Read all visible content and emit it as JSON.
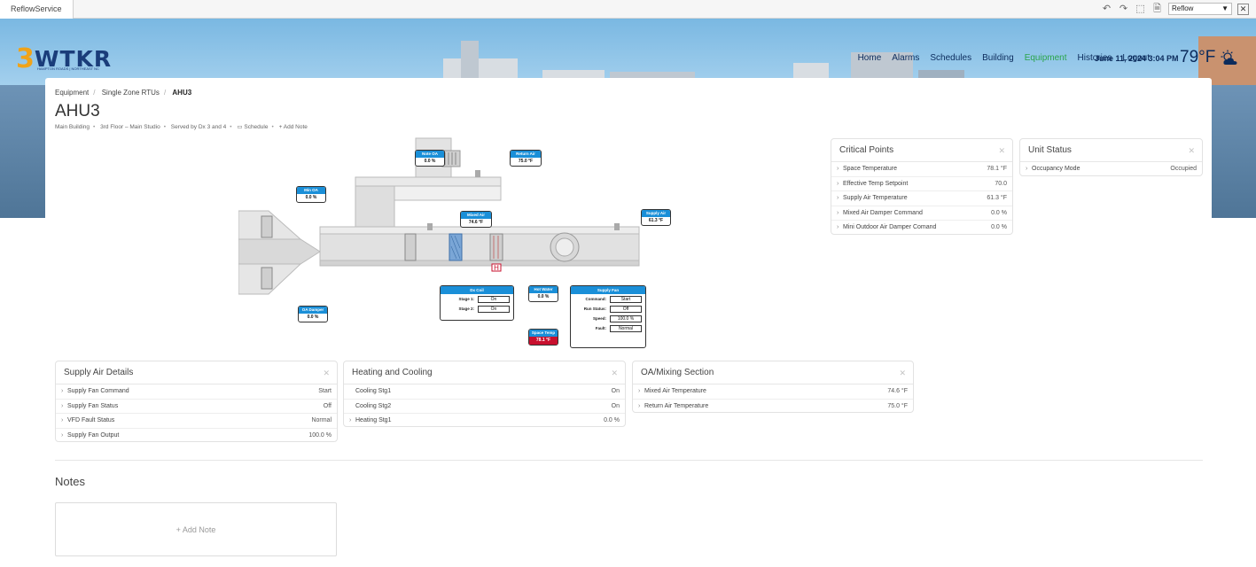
{
  "browser": {
    "tab_title": "ReflowService",
    "mode_select": "Reflow"
  },
  "brand": {
    "logo_numeral": "3",
    "logo_text": "WTKR",
    "logo_sub": "HAMPTON ROADS | NORTHEAST NC",
    "accent": "#f0a319",
    "primary": "#1a3d7a"
  },
  "nav": {
    "items": [
      "Home",
      "Alarms",
      "Schedules",
      "Building",
      "Equipment",
      "Histories",
      "Logout"
    ],
    "active": "Equipment",
    "active_color": "#2aa44a",
    "datetime": "June 11, 2024 3:04 PM",
    "temperature": "79°F",
    "weather_icon": "partly-cloudy-icon"
  },
  "breadcrumb": [
    "Equipment",
    "Single Zone RTUs",
    "AHU3"
  ],
  "page": {
    "title": "AHU3",
    "meta": {
      "building": "Main Building",
      "floor": "3rd Floor – Main Studio",
      "served": "Served by Dx 3 and 4",
      "schedule": "Schedule",
      "add_note": "+ Add Note"
    }
  },
  "diagram": {
    "sensors": {
      "min_oa": {
        "label": "Min OA",
        "value": "0.0 %"
      },
      "note_oa": {
        "label": "Note OA",
        "value": "0.0 %"
      },
      "return_air": {
        "label": "Return Air",
        "value": "75.0 °F"
      },
      "mixed_air": {
        "label": "Mixed Air",
        "value": "74.6 °F"
      },
      "supply_air": {
        "label": "Supply Air",
        "value": "61.3 °F"
      },
      "oa_damper": {
        "label": "OA Damper",
        "value": "0.0 %"
      },
      "hot_water": {
        "label": "Hot Water",
        "value": "0.0 %"
      },
      "space_temp": {
        "label": "Space Temp",
        "value": "78.1 °F"
      }
    },
    "dx_coil": {
      "label": "Dx Coil",
      "stage1_label": "Stage 1:",
      "stage1": "On",
      "stage2_label": "Stage 2:",
      "stage2": "On"
    },
    "supply_fan": {
      "label": "Supply Fan",
      "command_label": "Command:",
      "command": "Start",
      "run_status_label": "Run Status:",
      "run_status": "Off",
      "speed_label": "Speed:",
      "speed": "100.0 %",
      "fault_label": "Fault:",
      "fault": "Normal"
    },
    "sensor_header_color": "#1a8fd8",
    "alarm_color": "#c8102e"
  },
  "widgets": {
    "critical_points": {
      "title": "Critical Points",
      "rows": [
        {
          "name": "Space Temperature",
          "value": "78.1 °F"
        },
        {
          "name": "Effective Temp Setpoint",
          "value": "70.0"
        },
        {
          "name": "Supply Air Temperature",
          "value": "61.3 °F"
        },
        {
          "name": "Mixed Air Damper Command",
          "value": "0.0 %"
        },
        {
          "name": "Mini Outdoor Air Damper Comand",
          "value": "0.0 %"
        }
      ]
    },
    "unit_status": {
      "title": "Unit Status",
      "rows": [
        {
          "name": "Occupancy Mode",
          "value": "Occupied"
        }
      ]
    },
    "supply_air_details": {
      "title": "Supply Air Details",
      "rows": [
        {
          "name": "Supply Fan Command",
          "value": "Start"
        },
        {
          "name": "Supply Fan Status",
          "value": "Off"
        },
        {
          "name": "VFD Fault Status",
          "value": "Normal"
        },
        {
          "name": "Supply Fan Output",
          "value": "100.0 %"
        }
      ]
    },
    "heating_cooling": {
      "title": "Heating and Cooling",
      "rows": [
        {
          "name": "Cooling Stg1",
          "value": "On"
        },
        {
          "name": "Cooling Stg2",
          "value": "On"
        },
        {
          "name": "Heating Stg1",
          "value": "0.0 %"
        }
      ]
    },
    "oa_mixing": {
      "title": "OA/Mixing Section",
      "rows": [
        {
          "name": "Mixed Air Temperature",
          "value": "74.6 °F"
        },
        {
          "name": "Return Air Temperature",
          "value": "75.0 °F"
        }
      ]
    }
  },
  "notes": {
    "title": "Notes",
    "add_label": "+ Add Note"
  }
}
